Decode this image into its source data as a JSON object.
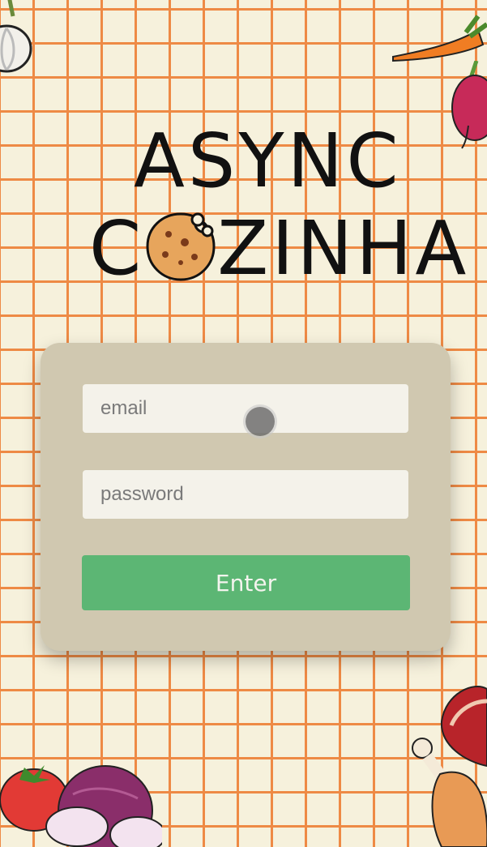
{
  "app": {
    "logo_line1": "ASYNC",
    "logo_line2_start": "C",
    "logo_line2_end": "ZINHA"
  },
  "login": {
    "email_placeholder": "email",
    "email_value": "",
    "password_placeholder": "password",
    "password_value": "",
    "enter_label": "Enter"
  },
  "colors": {
    "background": "#f6f1dc",
    "grid": "#ee8a45",
    "card": "#d0c8b0",
    "button": "#5cb674"
  },
  "decorations": [
    "garlic-icon",
    "carrot-icon",
    "beet-icon",
    "tomato-icon",
    "onion-icon",
    "meat-icon",
    "chicken-leg-icon",
    "cookie-icon"
  ]
}
